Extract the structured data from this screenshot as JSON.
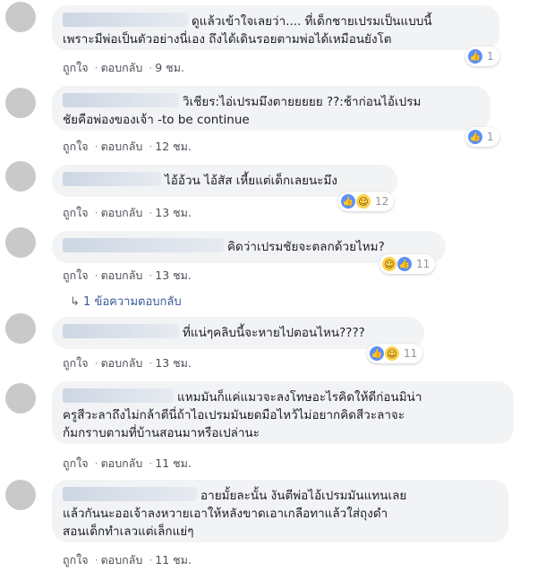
{
  "comments": [
    {
      "text": "ดูแล้วเข้าใจเลยว่า.... ที่เด็กชายเปรมเป็นแบบนี้\nเพราะมีพ่อเป็นตัวอย่างนี่เอง ถึงได้เดินรอยตามพ่อได้เหมือนยังโต",
      "like": "ถูกใจ",
      "reply": "ตอบกลับ",
      "time": "9 ชม.",
      "reactions": {
        "icons": [
          "like"
        ],
        "count": "1"
      }
    },
    {
      "text": "วิเชียร:ไอ่เปรมมึงตายยยยย ??:ช้าก่อนไอ้เปรม\nชัยคือพ่องของเจ้า -to be continue",
      "like": "ถูกใจ",
      "reply": "ตอบกลับ",
      "time": "12 ชม.",
      "reactions": {
        "icons": [
          "like"
        ],
        "count": "1"
      }
    },
    {
      "text": "ไอ้อ้วน ไอ้สัส เหี้ยแต่เด็กเลยนะมึง",
      "like": "ถูกใจ",
      "reply": "ตอบกลับ",
      "time": "13 ชม.",
      "reactions": {
        "icons": [
          "like",
          "haha"
        ],
        "count": "12"
      }
    },
    {
      "text": "คิดว่าเปรมชัยจะตลกด้วยไหม?",
      "like": "ถูกใจ",
      "reply": "ตอบกลับ",
      "time": "13 ชม.",
      "reactions": {
        "icons": [
          "haha",
          "like"
        ],
        "count": "11"
      },
      "replies": "1 ข้อความตอบกลับ"
    },
    {
      "text": "ที่แน่ๆคลิบนี้จะหายไปตอนไหน????",
      "like": "ถูกใจ",
      "reply": "ตอบกลับ",
      "time": "13 ชม.",
      "reactions": {
        "icons": [
          "like",
          "haha"
        ],
        "count": "11"
      }
    },
    {
      "text": "แหมมันก็แค่แมวจะลงโทษอะไรคิดให้ดีก่อนมิน่า\nครูสีวะลาถึงไม่กล้าตีนี่ถ้าไอเปรมมันยดมือไหว้ไม่อยากคิดสีวะลาจะ\nก้มกราบตามที่บ้านสอนมาหรือเปล่านะ",
      "like": "ถูกใจ",
      "reply": "ตอบกลับ",
      "time": "11 ชม."
    },
    {
      "text": "อายมั้ยละนั้น งันตีพ่อไอ้เปรมมันแทนเลย\nแล้วกันนะออเจ้าลงหวายเอาให้หลังขาดเอาเกลือทาแล้วใส่ถุงดำ\nสอนเด็กทำเลวแต่เล็กแย่ๆ",
      "like": "ถูกใจ",
      "reply": "ตอบกลับ",
      "time": "11 ชม."
    }
  ],
  "colors": {
    "bubble": "#f2f3f5",
    "link": "#385898",
    "like": "#5890ff",
    "haha": "#fcd14d"
  }
}
